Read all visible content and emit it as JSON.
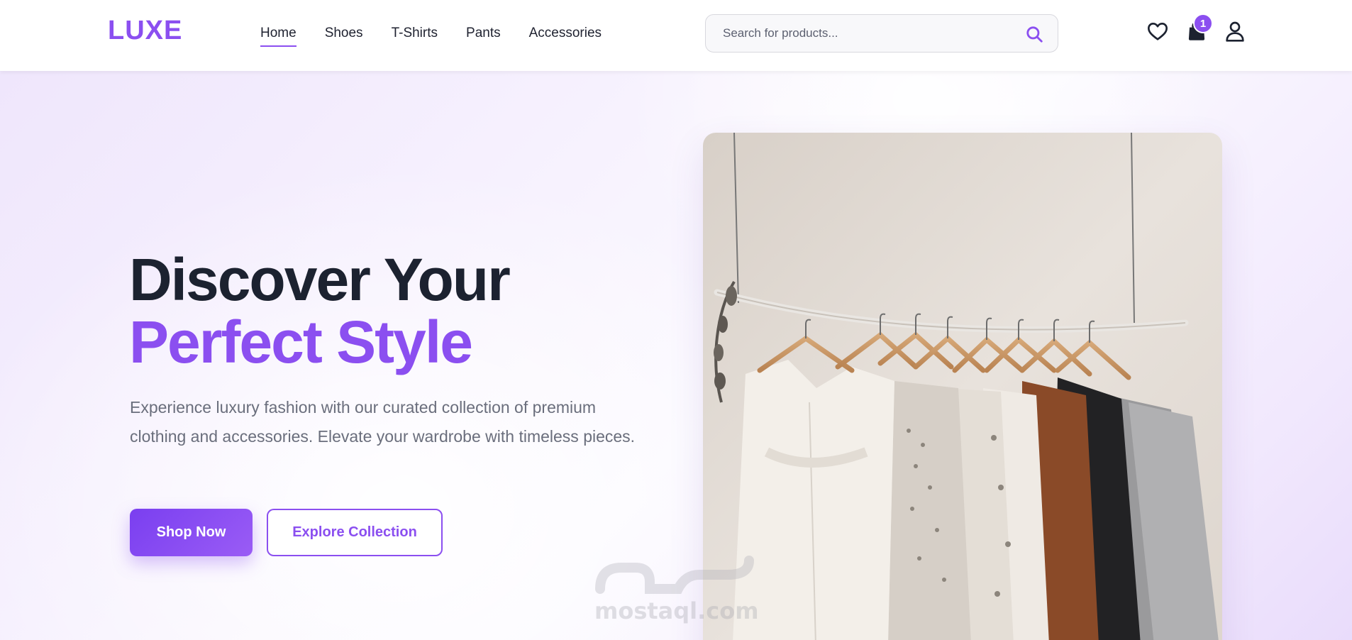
{
  "header": {
    "logo": "LUXE",
    "nav": [
      {
        "label": "Home",
        "active": true
      },
      {
        "label": "Shoes"
      },
      {
        "label": "T-Shirts"
      },
      {
        "label": "Pants"
      },
      {
        "label": "Accessories"
      }
    ],
    "search": {
      "placeholder": "Search for products...",
      "icon": "search-icon"
    },
    "icons": [
      "heart-icon",
      "shopping-bag-icon",
      "user-icon"
    ],
    "cart_count": "1"
  },
  "hero": {
    "title_line1": "Discover Your",
    "title_line2": "Perfect Style",
    "description": "Experience luxury fashion with our curated collection of premium clothing and accessories. Elevate your wardrobe with timeless pieces.",
    "primary_button": "Shop Now",
    "secondary_button": "Explore Collection",
    "image": "clothing-rack-photo"
  },
  "watermark": {
    "text": "mostaql.com"
  },
  "colors": {
    "accent": "#8b4ff0",
    "text_dark": "#1c2230",
    "text_muted": "#6a6e7c"
  }
}
